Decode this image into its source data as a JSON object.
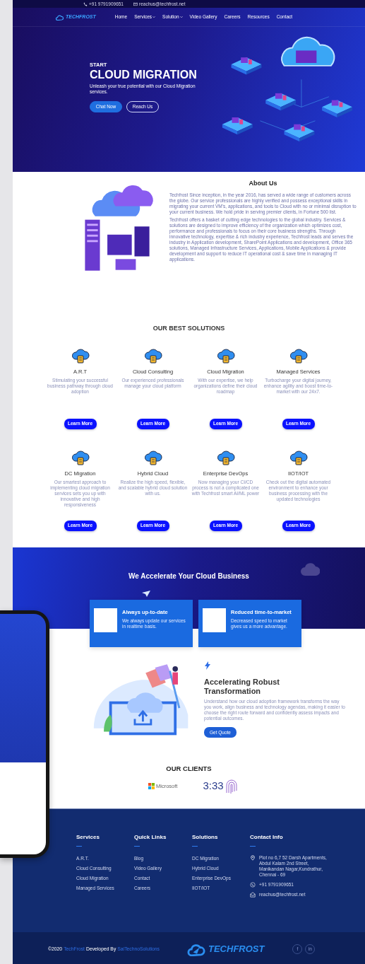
{
  "topbar": {
    "phone": "+91 9791909651",
    "email": "reachus@techfrost.net"
  },
  "nav": {
    "logo": "TECHFROST",
    "items": [
      {
        "label": "Home",
        "dropdown": false
      },
      {
        "label": "Services",
        "dropdown": true
      },
      {
        "label": "Solution",
        "dropdown": true
      },
      {
        "label": "Video Gallery",
        "dropdown": false
      },
      {
        "label": "Careers",
        "dropdown": false
      },
      {
        "label": "Resources",
        "dropdown": false
      },
      {
        "label": "Contact",
        "dropdown": false
      }
    ]
  },
  "hero": {
    "kicker": "START",
    "title": "CLOUD MIGRATION",
    "subtitle": "Unleash your true potential with our Cloud Migration services.",
    "buttons": [
      {
        "label": "Chat Now",
        "kind": "solid"
      },
      {
        "label": "Reach Us",
        "kind": "outline"
      }
    ]
  },
  "about": {
    "title": "About Us",
    "paragraphs": [
      "Techfrost Since inception, in the year 2016, has served a wide range of customers across the globe. Our service professionals are highly verified and possess exceptional skills in migrating your current VM's, applications, and tools to Cloud with no or minimal disruption to your current business. We hold pride in serving premier clients, in Fortune 500 list.",
      "Techfrost offers a basket of cutting edge technologies to the global industry. Services & solutions are designed to improve efficiency of the organization which optimizes cost, performance and professionals to focus on their core business strengths. Through innovative technology, expertise & rich industry experience, Techfrost leads and serves the industry in Application development, SharePoint Applications and development, Office 365 solutions, Managed Infrastructure Services, Applications, Mobile Applications & provide development and support to reduce IT operational cost & save time in managing IT applications."
    ]
  },
  "solutions": {
    "title": "OUR BEST SOLUTIONS",
    "items": [
      {
        "title": "A.R.T",
        "text": "Stimulating your successful business pathway through cloud adoption",
        "button": "Learn More"
      },
      {
        "title": "Cloud Consulting",
        "text": "Our experienced professionals manage your cloud platform",
        "button": "Learn More"
      },
      {
        "title": "Cloud Migration",
        "text": "With our expertise, we help organizations define their cloud roadmap",
        "button": "Learn More"
      },
      {
        "title": "Managed Services",
        "text": "Turbocharge your digital journey, enhance agility and boost time-to-market with our 24x7.",
        "button": "Learn More"
      },
      {
        "title": "DC Migration",
        "text": "Our smartest approach to implementing cloud migration services sets you up with innovative and high responsiveness",
        "button": "Learn More"
      },
      {
        "title": "Hybrid Cloud",
        "text": "Realize the high speed, flexible, and scalable hybrid cloud solution with us.",
        "button": "Learn More"
      },
      {
        "title": "Enterprise DevOps",
        "text": "Now managing your CI/CD process is not a complicated one with Techfrost smart AI/ML power",
        "button": "Learn More"
      },
      {
        "title": "IIOT/IOT",
        "text": "Check out the digital automated environment to enhance your business processing with the updated technologies",
        "button": "Learn More"
      }
    ]
  },
  "accelerate": {
    "title": "We Accelerate Your Cloud Business",
    "cards": [
      {
        "title": "Always up-to-date",
        "text": "We always update our services in realtime basis."
      },
      {
        "title": "Reduced time-to-market",
        "text": "Decreased speed to market gives us a more advantage."
      }
    ]
  },
  "transformation": {
    "title": "Accelerating Robust Transformation",
    "text": "Understand how our cloud adoption framework transforms the way you work, align business and technology agendas, making it easier to choose the right route forward and confidently assess impacts and potential outcomes.",
    "button": "Get Quote"
  },
  "clients": {
    "title": "OUR CLIENTS",
    "logos": [
      {
        "kind": "microsoft",
        "text": "Microsoft"
      },
      {
        "kind": "fingerprint",
        "text": "3:33"
      }
    ]
  },
  "footer": {
    "columns": [
      {
        "title": "Services",
        "links": [
          "A.R.T.",
          "Cloud Consulting",
          "Cloud Migration",
          "Managed Services"
        ]
      },
      {
        "title": "Quick Links",
        "links": [
          "Blog",
          "Video Gallery",
          "Contact",
          "Careers"
        ]
      },
      {
        "title": "Solutions",
        "links": [
          "DC Migration",
          "Hybrid Cloud",
          "Enterprise DevOps",
          "IIOT/IOT"
        ]
      }
    ],
    "contact": {
      "title": "Contact Info",
      "items": [
        {
          "kind": "address",
          "text": "Plot no 6,7 52 Darsh Apartments, Abdul Kalam 2nd Street, Manikandan Nagar,Kundrathur, Chennai - 69"
        },
        {
          "kind": "phone",
          "text": "+91 9791909651"
        },
        {
          "kind": "email",
          "text": "reachus@techfrost.net"
        }
      ]
    },
    "copyright": {
      "year": "©2020",
      "brand": "TechFrost",
      "developed_by": "Developed By",
      "developer": "SaiTechnoSolutions"
    },
    "logo": "TECHFROST",
    "social": [
      "f",
      "in"
    ]
  }
}
